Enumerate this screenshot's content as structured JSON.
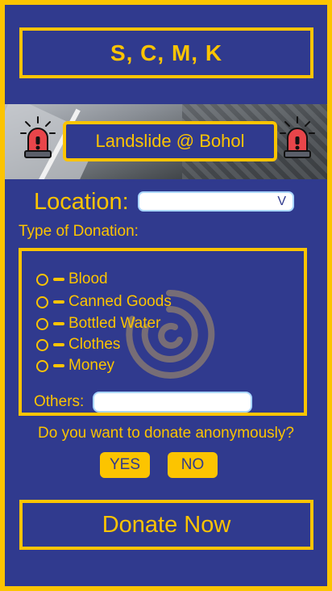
{
  "header": {
    "title": "S, C, M, K"
  },
  "event": {
    "label": "Landslide @ Bohol"
  },
  "location": {
    "label": "Location:",
    "dropdown_value": "",
    "dropdown_caret": "V"
  },
  "donation": {
    "type_label": "Type of Donation:",
    "options": [
      "Blood",
      "Canned Goods",
      "Bottled Water",
      "Clothes",
      "Money"
    ],
    "others_label": "Others:"
  },
  "anonymous": {
    "question": "Do you want to donate anonymously?",
    "yes_label": "YES",
    "no_label": "NO"
  },
  "submit": {
    "label": "Donate Now"
  },
  "colors": {
    "accent": "#fcc400",
    "background": "#303a8e",
    "input_border": "#a9d6ff"
  },
  "icons": {
    "siren": "siren-icon",
    "watermark": "spiral-watermark-icon"
  }
}
